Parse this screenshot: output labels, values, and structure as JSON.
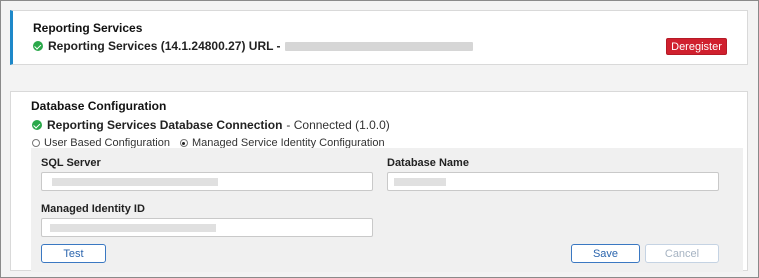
{
  "reporting_services": {
    "title": "Reporting Services",
    "status_label": "Reporting Services (14.1.24800.27) URL -",
    "deregister_label": "Deregister"
  },
  "database_config": {
    "title": "Database Configuration",
    "connection_label": "Reporting Services Database Connection",
    "connection_status": "- Connected (1.0.0)",
    "radio_options": [
      {
        "label": "User Based Configuration",
        "checked": false
      },
      {
        "label": "Managed Service Identity Configuration",
        "checked": true
      }
    ],
    "fields": {
      "sql_server_label": "SQL Server",
      "database_name_label": "Database Name",
      "managed_identity_label": "Managed Identity ID"
    },
    "buttons": {
      "test": "Test",
      "save": "Save",
      "cancel": "Cancel"
    }
  },
  "colors": {
    "accent_blue": "#1e88c9",
    "danger_red": "#d0202e",
    "success_green": "#2aa84a"
  }
}
